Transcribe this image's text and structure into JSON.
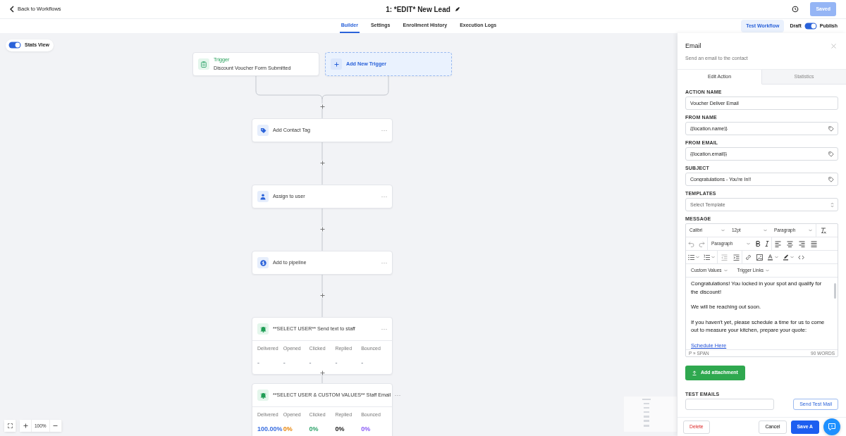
{
  "header": {
    "back_label": "Back to Workflows",
    "title": "1: *EDIT* New Lead",
    "save_button": "Saved",
    "save_disabled": true
  },
  "tabs": [
    {
      "label": "Builder",
      "selected": true
    },
    {
      "label": "Settings",
      "selected": false
    },
    {
      "label": "Enrollment History",
      "selected": false
    },
    {
      "label": "Execution Logs",
      "selected": false
    }
  ],
  "test_button": "Test Workflow",
  "publish": {
    "off_label": "Draft",
    "on_label": "Publish",
    "on": true
  },
  "stats_view": {
    "label": "Stats View",
    "on": true
  },
  "triggers": [
    {
      "kind": "trigger",
      "title": "Trigger",
      "subtitle": "Discount Voucher Form Submitted"
    },
    {
      "kind": "add",
      "title": "Add New Trigger"
    }
  ],
  "actions": [
    {
      "kind": "tag",
      "label": "Add Contact Tag"
    },
    {
      "kind": "user",
      "label": "Assign to user"
    },
    {
      "kind": "pipeline",
      "label": "Add to pipeline"
    },
    {
      "kind": "sms",
      "label": "**SELECT USER** Send text to staff",
      "stats": [
        {
          "label": "Delivered",
          "value": "-"
        },
        {
          "label": "Opened",
          "value": "-"
        },
        {
          "label": "Clicked",
          "value": "-"
        },
        {
          "label": "Replied",
          "value": "-"
        },
        {
          "label": "Bounced",
          "value": "-"
        }
      ]
    },
    {
      "kind": "email",
      "label": "**SELECT USER & CUSTOM VALUES** Staff Email",
      "stats": [
        {
          "label": "Delivered",
          "value": "100.00%",
          "color": "#3b6fe0"
        },
        {
          "label": "Opened",
          "value": "0%",
          "color": "#e8860c"
        },
        {
          "label": "Clicked",
          "value": "0%",
          "color": "#2ea36a"
        },
        {
          "label": "Replied",
          "value": "0%",
          "color": "#222222"
        },
        {
          "label": "Bounced",
          "value": "0%",
          "color": "#8b5cf6"
        }
      ]
    }
  ],
  "zoom": {
    "value": "100%"
  },
  "panel": {
    "title": "Email",
    "subtitle": "Send an email to the contact",
    "tabs": [
      {
        "label": "Edit Action",
        "selected": true
      },
      {
        "label": "Statistics",
        "selected": false
      }
    ],
    "fields": [
      {
        "kind": "text",
        "label": "ACTION NAME",
        "value": "Voucher Deliver Email"
      },
      {
        "kind": "tag",
        "label": "FROM NAME",
        "value": "{{location.name}}"
      },
      {
        "kind": "tag",
        "label": "FROM EMAIL",
        "value": "{{location.email}}"
      },
      {
        "kind": "tag",
        "label": "SUBJECT",
        "value": "Congratulations - You're In!!"
      },
      {
        "kind": "select",
        "label": "TEMPLATES",
        "placeholder": "Select Template"
      }
    ],
    "message": {
      "label": "MESSAGE",
      "font": "Calibri",
      "size": "12pt",
      "block": "Paragraph",
      "block_2": "Paragraph",
      "menus": [
        "Custom Values",
        "Trigger Links"
      ],
      "paragraphs": [
        {
          "kind": "text",
          "text": "Congratulations! You locked in your spot and qualify for the discount!"
        },
        {
          "kind": "text",
          "text": "We will be reaching out soon."
        },
        {
          "kind": "text",
          "text": "If you haven't yet, please schedule a time for us to come out to measure your kitchen, prepare your quote:"
        },
        {
          "kind": "link",
          "text": "Schedule Here"
        }
      ],
      "path": "P » SPAN",
      "word_count": "90 WORDS"
    },
    "attachment_button": "Add attachment",
    "test_emails": {
      "label": "TEST EMAILS",
      "button": "Send Test Mail"
    },
    "footer": {
      "delete": "Delete",
      "cancel": "Cancel",
      "save": "Save A"
    }
  }
}
